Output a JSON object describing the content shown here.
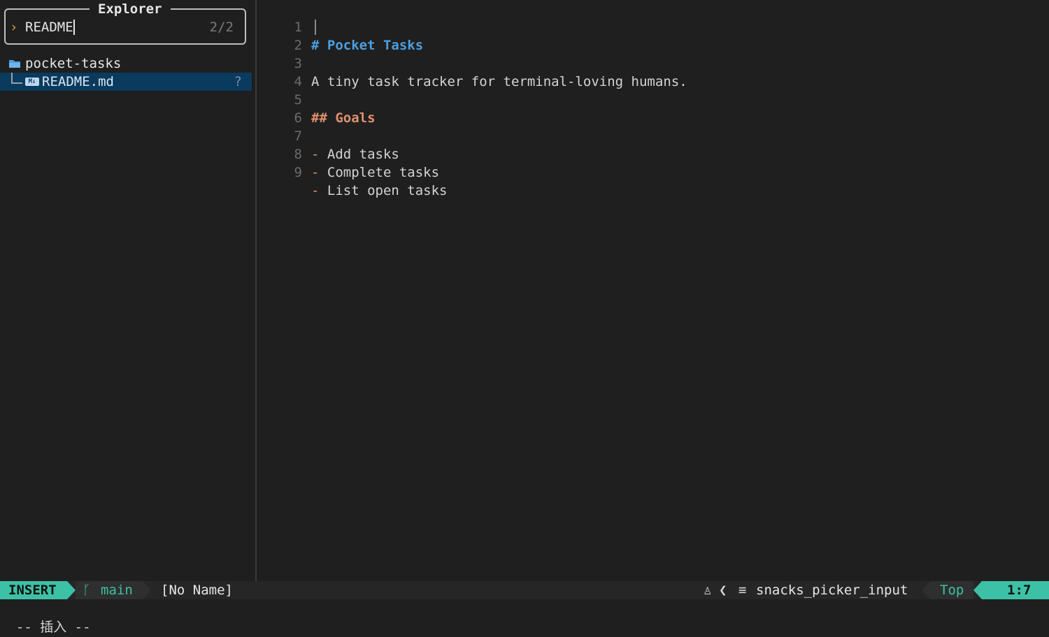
{
  "explorer": {
    "title": "Explorer",
    "prompt_icon": "chevron-right-icon",
    "search_value": "README",
    "match_count": "2/2",
    "tree": {
      "root": {
        "label": "pocket-tasks",
        "icon": "folder-open-icon"
      },
      "file": {
        "label": "README.md",
        "icon": "markdown-icon",
        "icon_text": "M↓",
        "git_status": "?"
      }
    }
  },
  "editor": {
    "lines": [
      {
        "num": "1",
        "text": "# Pocket Tasks"
      },
      {
        "num": "2",
        "text": ""
      },
      {
        "num": "3",
        "text": "A tiny task tracker for terminal-loving humans."
      },
      {
        "num": "4",
        "text": ""
      },
      {
        "num": "5",
        "text": "## Goals"
      },
      {
        "num": "6",
        "text": ""
      },
      {
        "num": "7",
        "dash": "-",
        "text": "Add tasks"
      },
      {
        "num": "8",
        "dash": "-",
        "text": "Complete tasks"
      },
      {
        "num": "9",
        "dash": "-",
        "text": "List open tasks"
      }
    ]
  },
  "statusline": {
    "mode": "INSERT",
    "branch": "main",
    "buffer": "[No Name]",
    "os_icon_glyph": "♙",
    "separator": "❮",
    "filetype_icon_glyph": "≡",
    "filetype": "snacks_picker_input",
    "scroll": "Top",
    "location": "1:7"
  },
  "cmdline": {
    "text": "-- 插入 --"
  },
  "colors": {
    "accent": "#3dc1a6",
    "heading1": "#4a9fe0",
    "heading2": "#e0926e",
    "selection": "#0a3a5e",
    "background": "#1f1f1f"
  }
}
